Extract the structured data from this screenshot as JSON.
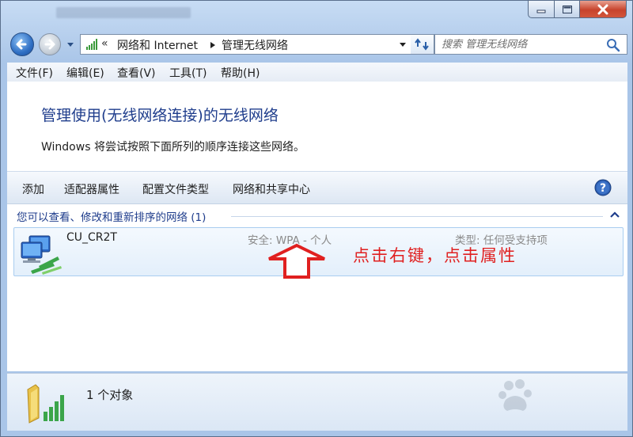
{
  "window": {
    "minimize_icon": "minimize-icon",
    "maximize_icon": "maximize-icon",
    "close_icon": "close-icon"
  },
  "navigation": {
    "address_prefix": "«",
    "breadcrumbs": [
      "网络和 Internet",
      "管理无线网络"
    ],
    "search_placeholder": "搜索 管理无线网络"
  },
  "menu": [
    "文件(F)",
    "编辑(E)",
    "查看(V)",
    "工具(T)",
    "帮助(H)"
  ],
  "page": {
    "heading": "管理使用(无线网络连接)的无线网络",
    "description": "Windows 将尝试按照下面所列的顺序连接这些网络。"
  },
  "commands": [
    "添加",
    "适配器属性",
    "配置文件类型",
    "网络和共享中心"
  ],
  "group": {
    "header": "您可以查看、修改和重新排序的网络 (1)"
  },
  "networks": [
    {
      "name": "CU_CR2T",
      "security": "安全: WPA - 个人",
      "type": "类型: 任何受支持项"
    }
  ],
  "annotation": {
    "text": "点击右键，点击属性",
    "color": "#e02020"
  },
  "status": {
    "object_count": "1 个对象"
  },
  "colors": {
    "heading": "#1f3d8c",
    "accent": "#2f6fc4",
    "annotation": "#e02020"
  }
}
